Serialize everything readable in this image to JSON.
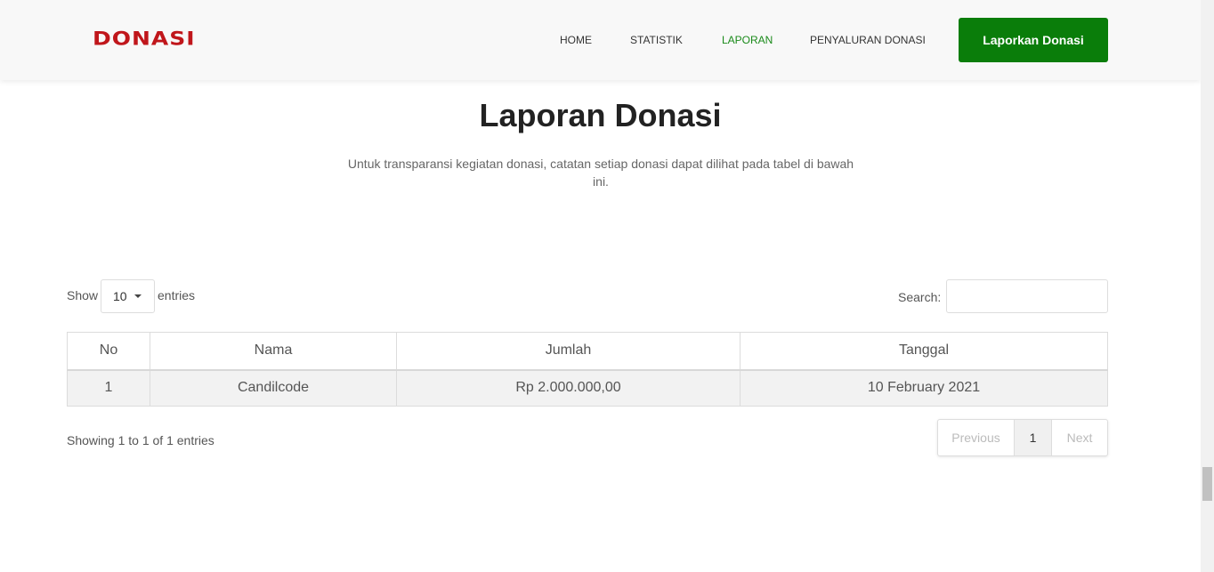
{
  "brand": {
    "logo_text": "DONASI",
    "logo_color": "#c0161b",
    "accent_color": "#0a7d0a"
  },
  "nav": {
    "items": [
      {
        "label": "HOME",
        "active": false
      },
      {
        "label": "STATISTIK",
        "active": false
      },
      {
        "label": "LAPORAN",
        "active": true
      },
      {
        "label": "PENYALURAN DONASI",
        "active": false
      }
    ],
    "cta_label": "Laporkan Donasi"
  },
  "page": {
    "title": "Laporan Donasi",
    "subtitle": "Untuk transparansi kegiatan donasi, catatan setiap donasi dapat dilihat pada tabel di bawah ini."
  },
  "table_controls": {
    "show_label": "Show",
    "entries_label": "entries",
    "page_length": "10",
    "search_label": "Search:",
    "search_value": ""
  },
  "table": {
    "headers": [
      "No",
      "Nama",
      "Jumlah",
      "Tanggal"
    ],
    "rows": [
      [
        "1",
        "Candilcode",
        "Rp 2.000.000,00",
        "10 February 2021"
      ]
    ]
  },
  "footer": {
    "info": "Showing 1 to 1 of 1 entries",
    "previous_label": "Previous",
    "current_page": "1",
    "next_label": "Next"
  }
}
